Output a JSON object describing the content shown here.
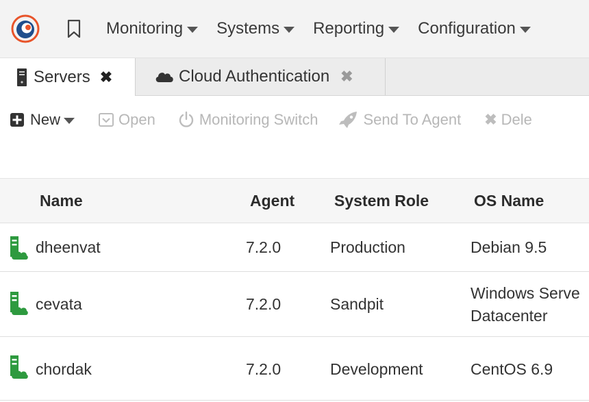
{
  "nav": {
    "menus": [
      {
        "label": "Monitoring"
      },
      {
        "label": "Systems"
      },
      {
        "label": "Reporting"
      },
      {
        "label": "Configuration"
      }
    ],
    "icons": {
      "logo": "app-logo",
      "bookmark": "bookmark-icon"
    }
  },
  "tabs": [
    {
      "label": "Servers",
      "icon": "server-icon",
      "active": true
    },
    {
      "label": "Cloud Authentication",
      "icon": "cloud-icon",
      "active": false
    }
  ],
  "toolbar": {
    "new_label": "New",
    "open_label": "Open",
    "monitoring_switch_label": "Monitoring Switch",
    "send_to_agent_label": "Send To Agent",
    "delete_label": "Dele"
  },
  "table": {
    "columns": [
      "Name",
      "Agent",
      "System Role",
      "OS Name"
    ],
    "rows": [
      {
        "name": "dheenvat",
        "agent": "7.2.0",
        "role": "Production",
        "os": [
          "Debian 9.5"
        ]
      },
      {
        "name": "cevata",
        "agent": "7.2.0",
        "role": "Sandpit",
        "os": [
          "Windows Serve",
          "Datacenter"
        ]
      },
      {
        "name": "chordak",
        "agent": "7.2.0",
        "role": "Development",
        "os": [
          "CentOS 6.9"
        ]
      }
    ]
  },
  "colors": {
    "accent": "#e8542a",
    "logo_blue": "#1f4e8c",
    "server_green": "#2e9a3f"
  }
}
